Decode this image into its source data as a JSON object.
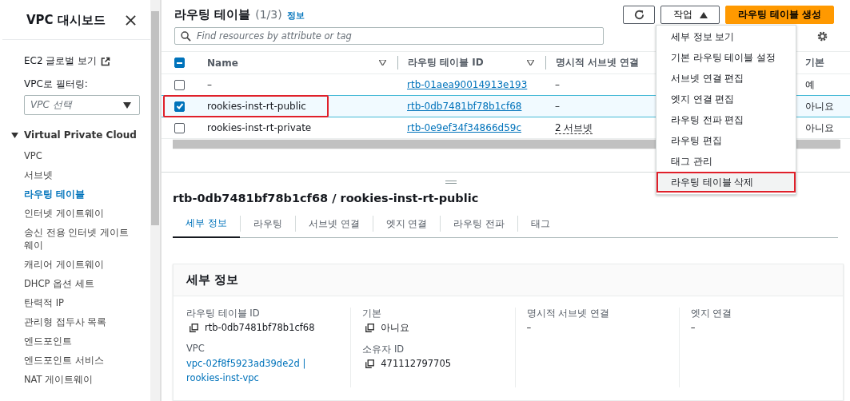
{
  "sidebar": {
    "title": "VPC 대시보드",
    "global_view_link": "EC2 글로벌 보기",
    "filter_label": "VPC로 필터링:",
    "filter_select": {
      "placeholder": "VPC 선택"
    },
    "section": {
      "label": "Virtual Private Cloud",
      "expanded": true
    },
    "items": [
      {
        "label": "VPC",
        "selected": false
      },
      {
        "label": "서브넷",
        "selected": false
      },
      {
        "label": "라우팅 테이블",
        "selected": true
      },
      {
        "label": "인터넷 게이트웨이",
        "selected": false
      },
      {
        "label": "송신 전용 인터넷 게이트웨이",
        "selected": false
      },
      {
        "label": "캐리어 게이트웨이",
        "selected": false
      },
      {
        "label": "DHCP 옵션 세트",
        "selected": false
      },
      {
        "label": "탄력적 IP",
        "selected": false
      },
      {
        "label": "관리형 접두사 목록",
        "selected": false
      },
      {
        "label": "엔드포인트",
        "selected": false
      },
      {
        "label": "엔드포인트 서비스",
        "selected": false
      },
      {
        "label": "NAT 게이트웨이",
        "selected": false
      }
    ]
  },
  "table_panel": {
    "title": "라우팅 테이블",
    "count": "(1/3)",
    "info_link": "정보",
    "actions_button": "작업",
    "create_button": "라우팅 테이블 생성",
    "search": {
      "placeholder": "Find resources by attribute or tag"
    },
    "select_all": {
      "indeterminate": true
    },
    "columns": [
      "Name",
      "라우팅 테이블 ID",
      "명시적 서브넷 연결",
      "기본"
    ],
    "rows": [
      {
        "selected": false,
        "outlined": false,
        "name": "–",
        "id": "rtb-01aea90014913e193",
        "subnets": "–",
        "subnets_link": false,
        "default": "예"
      },
      {
        "selected": true,
        "outlined": true,
        "name": "rookies-inst-rt-public",
        "id": "rtb-0db7481bf78b1cf68",
        "subnets": "–",
        "subnets_link": false,
        "default": "아니요"
      },
      {
        "selected": false,
        "outlined": false,
        "name": "rookies-inst-rt-private",
        "id": "rtb-0e9ef34f34866d59c",
        "subnets": "2 서브넷",
        "subnets_link": true,
        "default": "아니요"
      }
    ]
  },
  "actions_menu": [
    {
      "label": "세부 정보 보기",
      "outlined": false
    },
    {
      "label": "기본 라우팅 테이블 설정",
      "outlined": false
    },
    {
      "label": "서브넷 연결 편집",
      "outlined": false
    },
    {
      "label": "엣지 연결 편집",
      "outlined": false
    },
    {
      "label": "라우팅 전파 편집",
      "outlined": false
    },
    {
      "label": "라우팅 편집",
      "outlined": false
    },
    {
      "label": "태그 관리",
      "outlined": false
    },
    {
      "label": "라우팅 테이블 삭제",
      "outlined": true
    }
  ],
  "detail": {
    "title": "rtb-0db7481bf78b1cf68 / rookies-inst-rt-public",
    "tabs": [
      {
        "label": "세부 정보",
        "selected": true
      },
      {
        "label": "라우팅",
        "selected": false
      },
      {
        "label": "서브넷 연결",
        "selected": false
      },
      {
        "label": "엣지 연결",
        "selected": false
      },
      {
        "label": "라우팅 전파",
        "selected": false
      },
      {
        "label": "태그",
        "selected": false
      }
    ],
    "card_title": "세부 정보",
    "columns": [
      [
        {
          "label": "라우팅 테이블 ID",
          "value": "rtb-0db7481bf78b1cf68",
          "kind": "copy"
        },
        {
          "label": "VPC",
          "value": "vpc-02f8f5923ad39de2d | rookies-inst-vpc",
          "kind": "link"
        }
      ],
      [
        {
          "label": "기본",
          "value": "아니요",
          "kind": "copy"
        },
        {
          "label": "소유자 ID",
          "value": "471112797705",
          "kind": "copy"
        }
      ],
      [
        {
          "label": "명시적 서브넷 연결",
          "value": "–",
          "kind": "plain"
        }
      ],
      [
        {
          "label": "엣지 연결",
          "value": "–",
          "kind": "plain"
        }
      ]
    ]
  }
}
